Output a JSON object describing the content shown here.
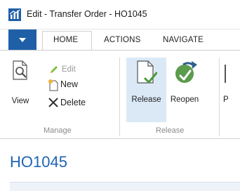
{
  "window": {
    "title": "Edit - Transfer Order - HO1045"
  },
  "tabs": [
    {
      "label": "HOME"
    },
    {
      "label": "ACTIONS"
    },
    {
      "label": "NAVIGATE"
    }
  ],
  "ribbon": {
    "manage": {
      "label": "Manage",
      "view": "View",
      "edit": "Edit",
      "new": "New",
      "delete": "Delete"
    },
    "release": {
      "label": "Release",
      "release_btn": "Release",
      "reopen_btn": "Reopen",
      "next_btn": "P"
    }
  },
  "page": {
    "title": "HO1045"
  },
  "colors": {
    "accent": "#1f5fa8",
    "title": "#1f64b4",
    "selected": "#dbe9f7"
  }
}
